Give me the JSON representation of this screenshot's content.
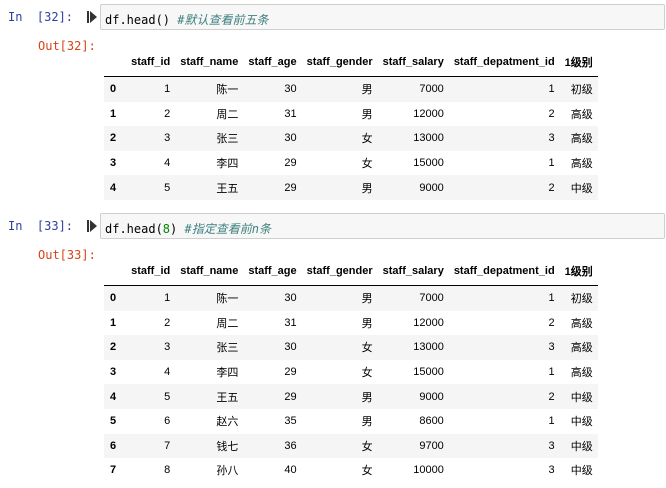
{
  "cells": [
    {
      "in_label": "In",
      "in_number": "[32]:",
      "code_prefix": "df.head()",
      "code_arg": "",
      "code_suffix": "",
      "code_comment": "#默认查看前五条",
      "out_label": "Out[32]:",
      "columns": [
        "",
        "staff_id",
        "staff_name",
        "staff_age",
        "staff_gender",
        "staff_salary",
        "staff_depatment_id",
        "1级别"
      ],
      "rows": [
        [
          "0",
          "1",
          "陈一",
          "30",
          "男",
          "7000",
          "1",
          "初级"
        ],
        [
          "1",
          "2",
          "周二",
          "31",
          "男",
          "12000",
          "2",
          "高级"
        ],
        [
          "2",
          "3",
          "张三",
          "30",
          "女",
          "13000",
          "3",
          "高级"
        ],
        [
          "3",
          "4",
          "李四",
          "29",
          "女",
          "15000",
          "1",
          "高级"
        ],
        [
          "4",
          "5",
          "王五",
          "29",
          "男",
          "9000",
          "2",
          "中级"
        ]
      ]
    },
    {
      "in_label": "In",
      "in_number": "[33]:",
      "code_prefix": "df.head(",
      "code_arg": "8",
      "code_suffix": ")",
      "code_comment": "#指定查看前n条",
      "out_label": "Out[33]:",
      "columns": [
        "",
        "staff_id",
        "staff_name",
        "staff_age",
        "staff_gender",
        "staff_salary",
        "staff_depatment_id",
        "1级别"
      ],
      "rows": [
        [
          "0",
          "1",
          "陈一",
          "30",
          "男",
          "7000",
          "1",
          "初级"
        ],
        [
          "1",
          "2",
          "周二",
          "31",
          "男",
          "12000",
          "2",
          "高级"
        ],
        [
          "2",
          "3",
          "张三",
          "30",
          "女",
          "13000",
          "3",
          "高级"
        ],
        [
          "3",
          "4",
          "李四",
          "29",
          "女",
          "15000",
          "1",
          "高级"
        ],
        [
          "4",
          "5",
          "王五",
          "29",
          "男",
          "9000",
          "2",
          "中级"
        ],
        [
          "5",
          "6",
          "赵六",
          "35",
          "男",
          "8600",
          "1",
          "中级"
        ],
        [
          "6",
          "7",
          "钱七",
          "36",
          "女",
          "9700",
          "3",
          "中级"
        ],
        [
          "7",
          "8",
          "孙八",
          "40",
          "女",
          "10000",
          "3",
          "中级"
        ]
      ]
    }
  ],
  "icons": {
    "run": "run-cell-icon"
  },
  "colors": {
    "in_prompt": "#303f9f",
    "out_prompt": "#d84315",
    "comment": "#408080",
    "number": "#008800",
    "input_bg": "#f7f7f7"
  }
}
